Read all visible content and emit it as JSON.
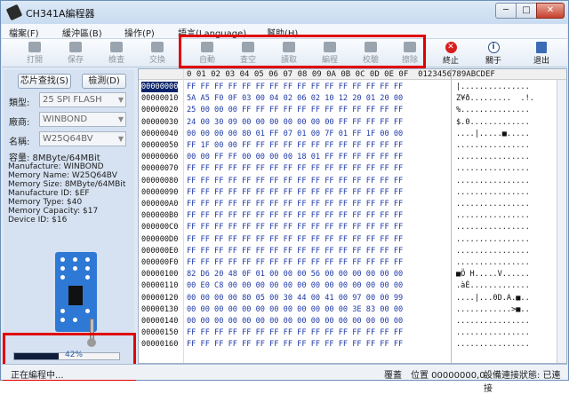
{
  "window": {
    "title": "CH341A編程器",
    "min": "─",
    "max": "□",
    "close": "✕"
  },
  "menu": [
    "檔案(F)",
    "緩沖區(B)",
    "操作(P)",
    "語言(Language)",
    "幫助(H)"
  ],
  "toolbar": [
    {
      "label": "打開",
      "icon": "folder-icon",
      "active": false
    },
    {
      "label": "保存",
      "icon": "save-icon",
      "active": false
    },
    {
      "label": "檢查",
      "icon": "check-icon",
      "active": false
    },
    {
      "label": "交換",
      "icon": "swap-icon",
      "active": false
    },
    {
      "label": "自動",
      "icon": "auto-icon",
      "active": false
    },
    {
      "label": "查空",
      "icon": "blank-check-icon",
      "active": false
    },
    {
      "label": "讀取",
      "icon": "read-icon",
      "active": false
    },
    {
      "label": "編程",
      "icon": "program-icon",
      "active": false
    },
    {
      "label": "校驗",
      "icon": "verify-icon",
      "active": false
    },
    {
      "label": "擦除",
      "icon": "erase-icon",
      "active": false
    },
    {
      "label": "終止",
      "icon": "stop-icon",
      "active": true
    },
    {
      "label": "關于",
      "icon": "info-icon",
      "active": true
    },
    {
      "label": "退出",
      "icon": "exit-icon",
      "active": true
    }
  ],
  "left": {
    "search_button": "芯片查找(S)",
    "detect_button": "檢測(D)",
    "type_label": "類型:",
    "type_value": "25 SPI FLASH",
    "vendor_label": "廠商:",
    "vendor_value": "WINBOND",
    "name_label": "名稱:",
    "name_value": "W25Q64BV",
    "capacity": "容量: 8MByte/64MBit",
    "info_lines": [
      "Manufacture: WINBOND",
      "Memory Name: W25Q64BV",
      "Memory Size: 8MByte/64MBit",
      "Manufacture ID: $EF",
      "Memory Type: $40",
      "Memory Capacity: $17",
      "Device ID: $16"
    ]
  },
  "progress": {
    "value": 0.42,
    "text": "42%"
  },
  "hex": {
    "header": "0 01 02 03 04 05 06 07 08 09 0A 0B 0C 0D 0E 0F  0123456789ABCDEF",
    "rows": [
      {
        "addr": "00000000",
        "bytes": "FF FF FF FF FF FF FF FF FF FF FF FF FF FF FF FF",
        "ascii": "|...............",
        "selected": true
      },
      {
        "addr": "00000010",
        "bytes": "5A A5 F0 0F 03 00 04 02 06 02 10 12 20 01 20 00",
        "ascii": "Z¥ð.........  .!.",
        "selected": false
      },
      {
        "addr": "00000020",
        "bytes": "25 00 00 00 FF FF FF FF FF FF FF FF FF FF FF FF",
        "ascii": "%...............",
        "selected": false
      },
      {
        "addr": "00000030",
        "bytes": "24 00 30 09 00 00 00 00 00 00 00 FF FF FF FF FF",
        "ascii": "$.0.............",
        "selected": false
      },
      {
        "addr": "00000040",
        "bytes": "00 00 00 00 80 01 FF 07 01 00 7F 01 FF 1F 00 00",
        "ascii": "....|.....■.....",
        "selected": false
      },
      {
        "addr": "00000050",
        "bytes": "FF 1F 00 00 FF FF FF FF FF FF FF FF FF FF FF FF",
        "ascii": "................",
        "selected": false
      },
      {
        "addr": "00000060",
        "bytes": "00 00 FF FF 00 00 00 00 18 01 FF FF FF FF FF FF",
        "ascii": "................",
        "selected": false
      },
      {
        "addr": "00000070",
        "bytes": "FF FF FF FF FF FF FF FF FF FF FF FF FF FF FF FF",
        "ascii": "................",
        "selected": false
      },
      {
        "addr": "00000080",
        "bytes": "FF FF FF FF FF FF FF FF FF FF FF FF FF FF FF FF",
        "ascii": "................",
        "selected": false
      },
      {
        "addr": "00000090",
        "bytes": "FF FF FF FF FF FF FF FF FF FF FF FF FF FF FF FF",
        "ascii": "................",
        "selected": false
      },
      {
        "addr": "000000A0",
        "bytes": "FF FF FF FF FF FF FF FF FF FF FF FF FF FF FF FF",
        "ascii": "................",
        "selected": false
      },
      {
        "addr": "000000B0",
        "bytes": "FF FF FF FF FF FF FF FF FF FF FF FF FF FF FF FF",
        "ascii": "................",
        "selected": false
      },
      {
        "addr": "000000C0",
        "bytes": "FF FF FF FF FF FF FF FF FF FF FF FF FF FF FF FF",
        "ascii": "................",
        "selected": false
      },
      {
        "addr": "000000D0",
        "bytes": "FF FF FF FF FF FF FF FF FF FF FF FF FF FF FF FF",
        "ascii": "................",
        "selected": false
      },
      {
        "addr": "000000E0",
        "bytes": "FF FF FF FF FF FF FF FF FF FF FF FF FF FF FF FF",
        "ascii": "................",
        "selected": false
      },
      {
        "addr": "000000F0",
        "bytes": "FF FF FF FF FF FF FF FF FF FF FF FF FF FF FF FF",
        "ascii": "................",
        "selected": false
      },
      {
        "addr": "00000100",
        "bytes": "82 D6 20 48 0F 01 00 00 00 56 00 00 00 00 00 00",
        "ascii": "■Ö H.....V......",
        "selected": false
      },
      {
        "addr": "00000110",
        "bytes": "00 E0 C8 00 00 00 00 00 00 00 00 00 00 00 00 00",
        "ascii": ".àÈ.............",
        "selected": false
      },
      {
        "addr": "00000120",
        "bytes": "00 00 00 00 80 05 00 30 44 00 41 00 97 00 00 99",
        "ascii": "....|...0D.A.■..",
        "selected": false
      },
      {
        "addr": "00000130",
        "bytes": "00 00 00 00 00 00 00 00 00 00 00 00 3E 83 00 00",
        "ascii": "............>■..",
        "selected": false
      },
      {
        "addr": "00000140",
        "bytes": "00 00 00 00 00 00 00 00 00 00 00 00 00 00 00 00",
        "ascii": "................",
        "selected": false
      },
      {
        "addr": "00000150",
        "bytes": "FF FF FF FF FF FF FF FF FF FF FF FF FF FF FF FF",
        "ascii": "................",
        "selected": false
      },
      {
        "addr": "00000160",
        "bytes": "FF FF FF FF FF FF FF FF FF FF FF FF FF FF FF FF",
        "ascii": "................",
        "selected": false
      }
    ]
  },
  "status": {
    "left": "正在編程中...",
    "mode": "覆蓋",
    "position": "位置 00000000,0",
    "device": "設備連接狀態: 已連接"
  }
}
